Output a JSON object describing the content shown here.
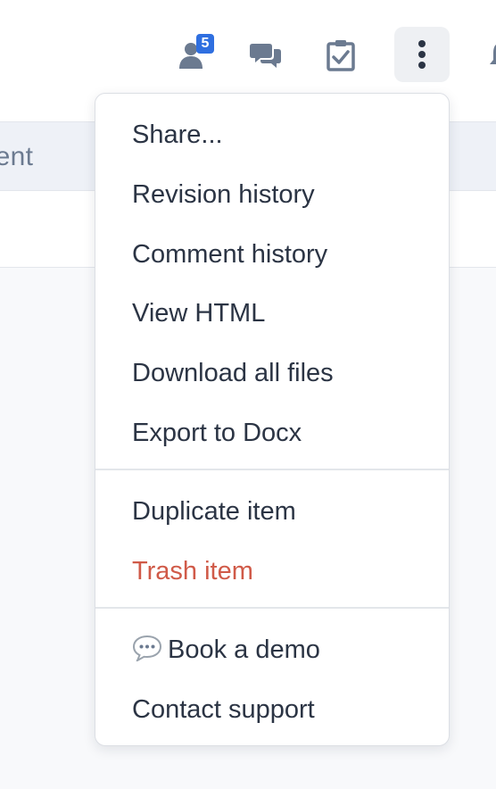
{
  "topbar": {
    "people_badge": "5",
    "icons": [
      "people-icon",
      "chat-icon",
      "task-check-icon",
      "more-vertical-icon",
      "bell-icon"
    ]
  },
  "content": {
    "header_label": "tent"
  },
  "menu": {
    "share": "Share...",
    "revision_history": "Revision history",
    "comment_history": "Comment history",
    "view_html": "View HTML",
    "download_all": "Download all files",
    "export_docx": "Export to Docx",
    "duplicate_item": "Duplicate item",
    "trash_item": "Trash item",
    "book_demo": "Book a demo",
    "contact_support": "Contact support"
  },
  "colors": {
    "accent_badge": "#2f6fe0",
    "danger": "#d05a48",
    "icon_gray": "#6b7a90",
    "text": "#2b3444"
  }
}
